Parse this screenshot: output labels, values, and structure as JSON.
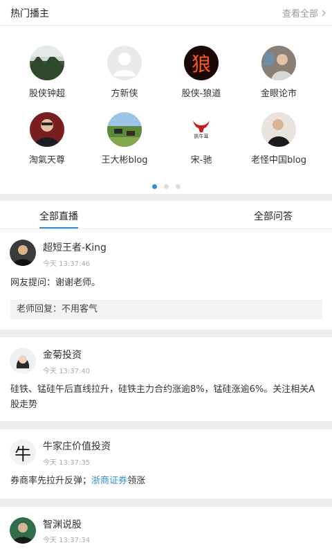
{
  "header": {
    "title": "热门播主",
    "more": "查看全部"
  },
  "hosts": [
    {
      "name": "股侠钟超"
    },
    {
      "name": "方新侠"
    },
    {
      "name": "股侠-狼道",
      "avatar_text": "狼"
    },
    {
      "name": "金眼论市"
    },
    {
      "name": "淘氣天尊"
    },
    {
      "name": "王大彬blog"
    },
    {
      "name": "宋-驰",
      "avatar_text": "执牛耳"
    },
    {
      "name": "老怪中国blog"
    }
  ],
  "pager": {
    "active_index": 0,
    "count": 3
  },
  "tabs": {
    "live": "全部直播",
    "qa": "全部问答"
  },
  "feed": [
    {
      "name": "超短王者-King",
      "time": "今天 13:37:46",
      "content": "网友提问：谢谢老师。",
      "reply": "老师回复：不用客气"
    },
    {
      "name": "金菊投资",
      "time": "今天 13:37:40",
      "content": "硅铁、锰硅午后直线拉升，硅铁主力合约涨逾8%，锰硅涨逾6%。关注相关A股走势"
    },
    {
      "name": "牛家庄价值投资",
      "time": "今天 13:37:35",
      "content_prefix": "券商率先拉升反弹；",
      "content_link": "浙商证券",
      "content_suffix": "领涨",
      "avatar_text": "牛"
    },
    {
      "name": "智渊说股",
      "time": "今天 13:37:34"
    }
  ],
  "colors": {
    "accent": "#2d8fdd",
    "background": "#ededed"
  }
}
